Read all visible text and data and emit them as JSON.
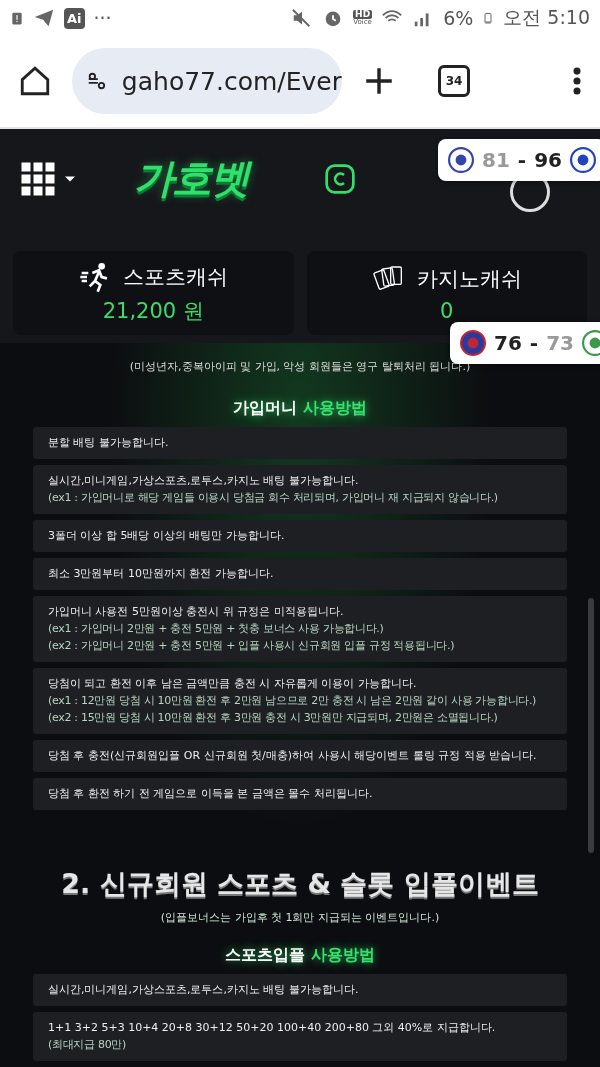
{
  "status_bar": {
    "left_badge": "Ai",
    "more": "···",
    "hd": "HD",
    "voice": "Voice",
    "battery": "6%",
    "time": "오전 5:10"
  },
  "browser": {
    "url": "gaho77.com/Ever",
    "tab_count": "34"
  },
  "header": {
    "logo": "가호벳"
  },
  "wallets": [
    {
      "kind": "sports",
      "label": "스포츠캐쉬",
      "amount": "21,200 원"
    },
    {
      "kind": "casino",
      "label": "카지노캐쉬",
      "amount": "0"
    }
  ],
  "scores": [
    {
      "home": {
        "score": "81",
        "dimmed": true
      },
      "separator": "-",
      "away": {
        "score": "96",
        "dimmed": false
      }
    },
    {
      "home": {
        "score": "76",
        "dimmed": false
      },
      "separator": "-",
      "away": {
        "score": "73",
        "dimmed": true
      }
    }
  ],
  "notice": "(미성년자,중복아이피 및 가입, 악성 회원들은 영구 탈퇴처리 됩니다.)",
  "sections": [
    {
      "heading": "가입머니",
      "heading_accent": "사용방법",
      "items": [
        {
          "text": "분할 배팅 불가능합니다."
        },
        {
          "text": "실시간,미니게임,가상스포츠,로투스,카지노 배팅 불가능합니다.",
          "notes": [
            "(ex1 : 가입머니로 해당 게임들 이용시 당첨금 회수 처리되며, 가입머니 재 지급되지 않습니다.)"
          ]
        },
        {
          "text": "3폴더 이상 합 5배당 이상의 배팅만 가능합니다."
        },
        {
          "text": "최소 3만원부터 10만원까지 환전 가능합니다."
        },
        {
          "text": "가입머니 사용전 5만원이상 충전시 위 규정은 미적용됩니다.",
          "notes": [
            "(ex1 : 가입머니 2만원 + 충전 5만원 + 첫충 보너스 사용 가능합니다.)",
            "(ex2 : 가입머니 2만원 + 충전 5만원 + 입플 사용시 신규회원 입플 규정 적용됩니다.)"
          ]
        },
        {
          "text": "당첨이 되고 환전 이후 남은 금액만큼 충전 시 자유롭게 이용이 가능합니다.",
          "notes": [
            "(ex1 : 12만원 당첨 시 10만원 환전 후 2만원 남으므로 2만 충전 시 남은 2만원 같이 사용 가능합니다.)",
            "(ex2 : 15만원 당첨 시 10만원 환전 후 3만원 충전 시 3만원만 지급되며, 2만원은 소멸됩니다.)"
          ]
        },
        {
          "text": "당첨 후 충전(신규회원입플 OR 신규회원 첫/매충)하여 사용시 해당이벤트 롤링 규정 적용 받습니다."
        },
        {
          "text": "당첨 후 환전 하기 전 게임으로 이득을 본 금액은 몰수 처리됩니다."
        }
      ]
    },
    {
      "title": "2. 신규회원 스포츠 & 슬롯 입플이벤트",
      "subtitle": "(입플보너스는 가입후 첫 1회만 지급되는 이벤트입니다.)",
      "heading": "스포츠입플",
      "heading_accent": "사용방법",
      "items": [
        {
          "text": "실시간,미니게임,가상스포츠,로투스,카지노 배팅 불가능합니다."
        },
        {
          "text": "1+1 3+2 5+3 10+4 20+8 30+12 50+20 100+40 200+80 그외 40%로 지급합니다.",
          "notes": [
            "(최대지급 80만)"
          ]
        }
      ]
    }
  ]
}
